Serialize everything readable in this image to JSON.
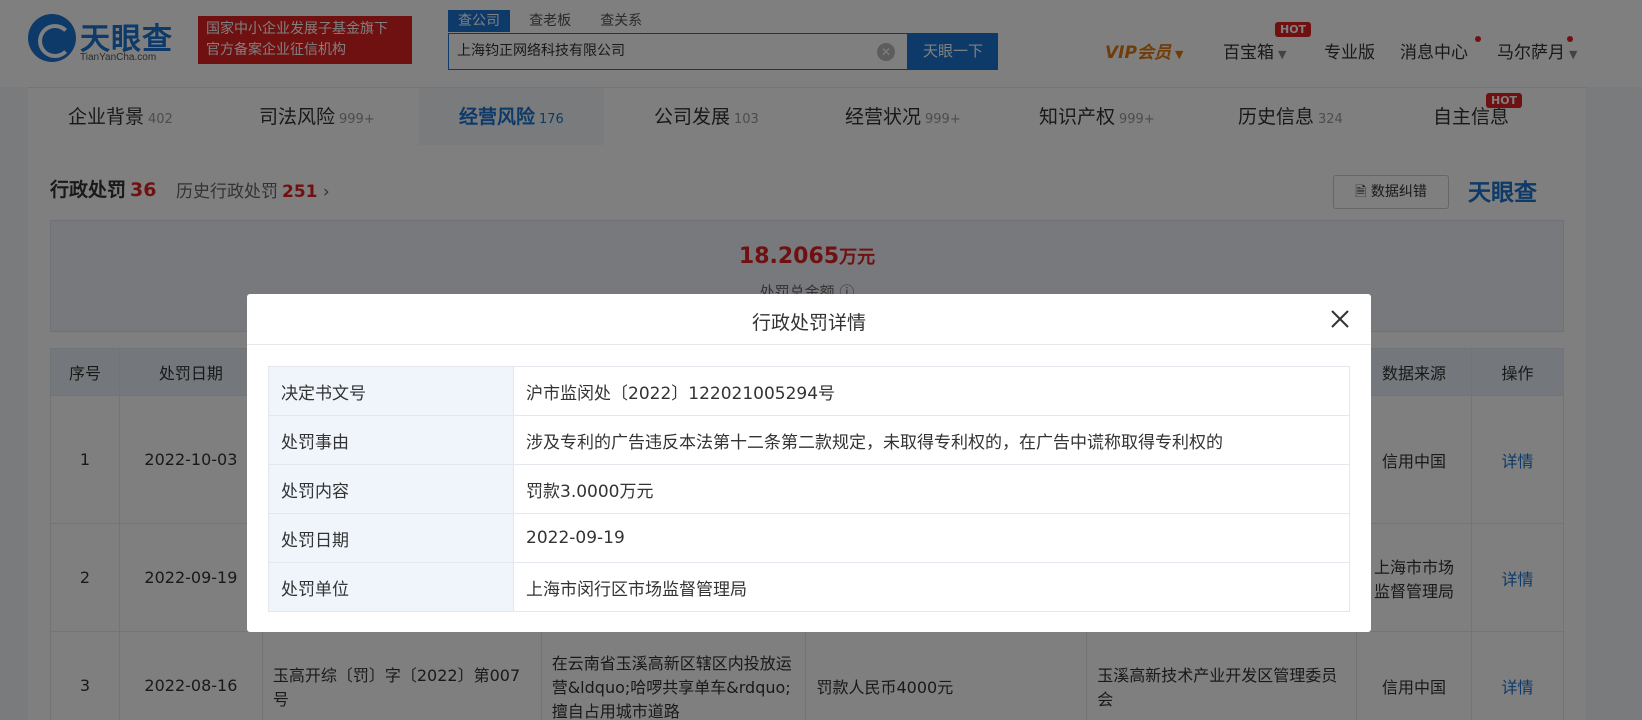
{
  "header": {
    "logo_text": "天眼查",
    "logo_sub": "TianYanCha.com",
    "slogan_line1": "国家中小企业发展子基金旗下",
    "slogan_line2": "官方备案企业征信机构",
    "search_tabs": [
      "查公司",
      "查老板",
      "查关系"
    ],
    "search_value": "上海钧正网络科技有限公司",
    "search_button": "天眼一下",
    "nav": {
      "vip": "VIP会员",
      "treasure": "百宝箱",
      "hot": "HOT",
      "pro": "专业版",
      "messages": "消息中心",
      "user": "马尔萨月"
    }
  },
  "categories": [
    {
      "label": "企业背景",
      "count": "402"
    },
    {
      "label": "司法风险",
      "count": "999+"
    },
    {
      "label": "经营风险",
      "count": "176"
    },
    {
      "label": "公司发展",
      "count": "103"
    },
    {
      "label": "经营状况",
      "count": "999+"
    },
    {
      "label": "知识产权",
      "count": "999+"
    },
    {
      "label": "历史信息",
      "count": "324"
    },
    {
      "label": "自主信息",
      "count": "",
      "badge": "HOT"
    }
  ],
  "section": {
    "title": "行政处罚",
    "count": "36",
    "history_label": "历史行政处罚",
    "history_count": "251",
    "feedback_button": "数据纠错",
    "watermark": "天眼查"
  },
  "summary": {
    "amount": "18.2065",
    "unit": "万元",
    "label": "处罚总金额"
  },
  "table": {
    "headers": [
      "序号",
      "处罚日期",
      "",
      "",
      "",
      "",
      "数据来源",
      "操作"
    ],
    "rows": [
      {
        "index": "1",
        "date": "2022-10-03",
        "doc": "",
        "reason": "",
        "content": "",
        "unit": "",
        "source": "信用中国",
        "action": "详情"
      },
      {
        "index": "2",
        "date": "2022-09-19",
        "doc": "",
        "reason": "",
        "content": "",
        "unit": "",
        "source": "上海市市场监督管理局",
        "action": "详情"
      },
      {
        "index": "3",
        "date": "2022-08-16",
        "doc": "玉高开综〔罚〕字〔2022〕第007号",
        "reason": "在云南省玉溪高新区辖区内投放运营&ldquo;哈啰共享单车&rdquo;擅自占用城市道路",
        "content": "罚款人民币4000元",
        "unit": "玉溪高新技术产业开发区管理委员会",
        "source": "信用中国",
        "action": "详情"
      }
    ]
  },
  "modal": {
    "title": "行政处罚详情",
    "rows": [
      {
        "key": "决定书文号",
        "value": "沪市监闵处〔2022〕122021005294号"
      },
      {
        "key": "处罚事由",
        "value": "涉及专利的广告违反本法第十二条第二款规定，未取得专利权的，在广告中谎称取得专利权的"
      },
      {
        "key": "处罚内容",
        "value": "罚款3.0000万元"
      },
      {
        "key": "处罚日期",
        "value": "2022-09-19"
      },
      {
        "key": "处罚单位",
        "value": "上海市闵行区市场监督管理局"
      }
    ]
  }
}
